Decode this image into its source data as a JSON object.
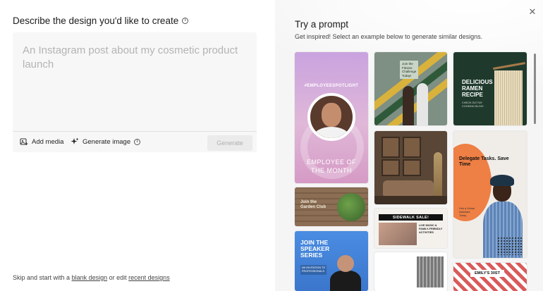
{
  "left": {
    "heading": "Describe the design you'd like to create",
    "prompt_placeholder": "An Instagram post about my cosmetic product launch",
    "toolbar": {
      "add_media": "Add media",
      "generate_image": "Generate image",
      "generate": "Generate"
    },
    "footer": {
      "prefix": "Skip and start with a",
      "blank_design": "blank design",
      "middle": "or edit",
      "recent_designs": "recent designs"
    }
  },
  "right": {
    "title": "Try a prompt",
    "subtitle": "Get inspired! Select an example below to generate similar designs.",
    "close_icon": "close-icon",
    "cards": [
      {
        "id": "employee",
        "texts": [
          "#EMPLOYEESPOTLIGHT",
          "EMPLOYEE OF",
          "THE MONTH"
        ]
      },
      {
        "id": "fitness",
        "texts": [
          "Join the",
          "Fitness",
          "Challenge",
          "Today!"
        ]
      },
      {
        "id": "ramen",
        "texts": [
          "DELICIOUS",
          "RAMEN",
          "RECIPE",
          "CHECK OUT MY",
          "COOKING BLOG!"
        ]
      },
      {
        "id": "garden",
        "texts": [
          "Join the",
          "Garden Club"
        ]
      },
      {
        "id": "speaker",
        "texts": [
          "JOIN THE",
          "SPEAKER",
          "SERIES",
          "AN INVITATION TO",
          "PROFESSIONALS"
        ]
      },
      {
        "id": "interior",
        "texts": []
      },
      {
        "id": "sidewalk",
        "texts": [
          "SIDEWALK SALE!",
          "LIVE MUSIC &",
          "FAMILY-FRIENDLY",
          "ACTIVITIES"
        ]
      },
      {
        "id": "delegate",
        "texts": [
          "Delegate Tasks. Save",
          "Time",
          "Hire a Virtual",
          "Assistant",
          "Today"
        ]
      },
      {
        "id": "emily",
        "texts": [
          "EMILY'S 30ST"
        ]
      }
    ]
  }
}
